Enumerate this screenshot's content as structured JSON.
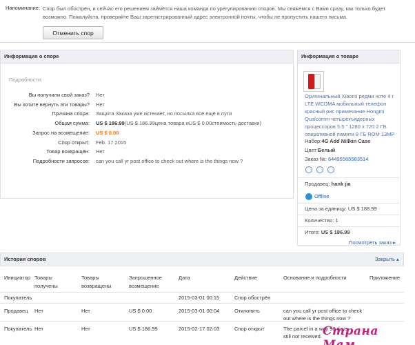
{
  "notice": {
    "label": "Напоминание:",
    "text": "Спор был обострён, и сейчас его решением займётся наша команда по урегулированию споров. Мы свяжемся с Вами сразу, как только будет возможно. Пожалуйста, проверяйте Ваш зарегистрированный адрес электронной почты, чтобы не пропустить нашего письма.",
    "cancel_button": "Отменить спор"
  },
  "dispute": {
    "title": "Информация о споре",
    "details_label": "Подробности:",
    "rows": [
      {
        "label": "Вы получили свой заказ?",
        "value": "Нет"
      },
      {
        "label": "Вы хотите вернуть эти товары?",
        "value": "Нет"
      },
      {
        "label": "Причина спора:",
        "value": "Защита Заказа уже истекает, но посылка всё ещё в пути"
      },
      {
        "label": "Общая сумма:",
        "value_bold": "US $ 186.99",
        "value_rest": "(US $ 186.99цена товара иUS $ 0.00стоимость доставки)"
      },
      {
        "label": "Запрос на возмещение:",
        "value": "US $ 0.00"
      },
      {
        "label": "Спор открыт:",
        "value": "Feb. 17 2015"
      },
      {
        "label": "Товар возвращён:",
        "value": "Нет"
      },
      {
        "label": "Подробности запросов:",
        "value": "can you call yr post office to check out where is the things now ?"
      }
    ]
  },
  "product": {
    "title": "Информация о товаре",
    "name": "Оригинальный Xiaomi редми ноте 4 г LTE WCDMA мобильный телефон красный рис примечание Hongmi Qualcomm четырехъядерных процессоров 5.5 \" 1280 x 720 2 ГБ оперативной памяти 8 ГБ ROM 13MP",
    "set_label": "Набор:",
    "set_value": "4G Add Nillkin Case",
    "color_label": "Цвет:",
    "color_value": "Белый",
    "order_label": "Заказ №:",
    "order_value": "64495565583514",
    "seller_label": "Продавец:",
    "seller_value": "hank jia",
    "status": "Offline",
    "unit_price": "Цена за единицу: US $ 188.99",
    "quantity": "Количество: 1",
    "total_label": "Итого:",
    "total_value": "US $ 186.99",
    "view_order": "Посмотреть заказ ▸"
  },
  "history": {
    "title": "История споров",
    "collapse": "Закрыть ▴",
    "headers": [
      "Инициатор",
      "Товары получены",
      "Товары возвращены",
      "Запрошенное возмещение",
      "Дата",
      "Действие",
      "Основание и подробности",
      "Приложение"
    ],
    "rows": [
      {
        "initiator": "Покупатель",
        "received": "",
        "returned": "",
        "refund": "",
        "date": "2015-03-01 00:15",
        "action": "Спор обострён",
        "reason": "",
        "attachment": ""
      },
      {
        "initiator": "Продавец",
        "received": "Нет",
        "returned": "Нет",
        "refund": "US $ 0.00",
        "date": "2015-03-01 00:04",
        "action": "Отклонить",
        "reason": "can you call yr post office to check out where is the things now ?",
        "attachment": ""
      },
      {
        "initiator": "Покупатель",
        "received": "Нет",
        "returned": "Нет",
        "refund": "US $ 186.99",
        "date": "2015-02-17 02:03",
        "action": "Спор открыт",
        "reason": "The parcel in a way 90 days still not received.",
        "attachment": ""
      }
    ]
  },
  "watermark": "Страна Мам",
  "colors": {
    "accent_orange": "#e8760c",
    "link_blue": "#2d5fa8",
    "panel_header": "#eef0f3"
  }
}
